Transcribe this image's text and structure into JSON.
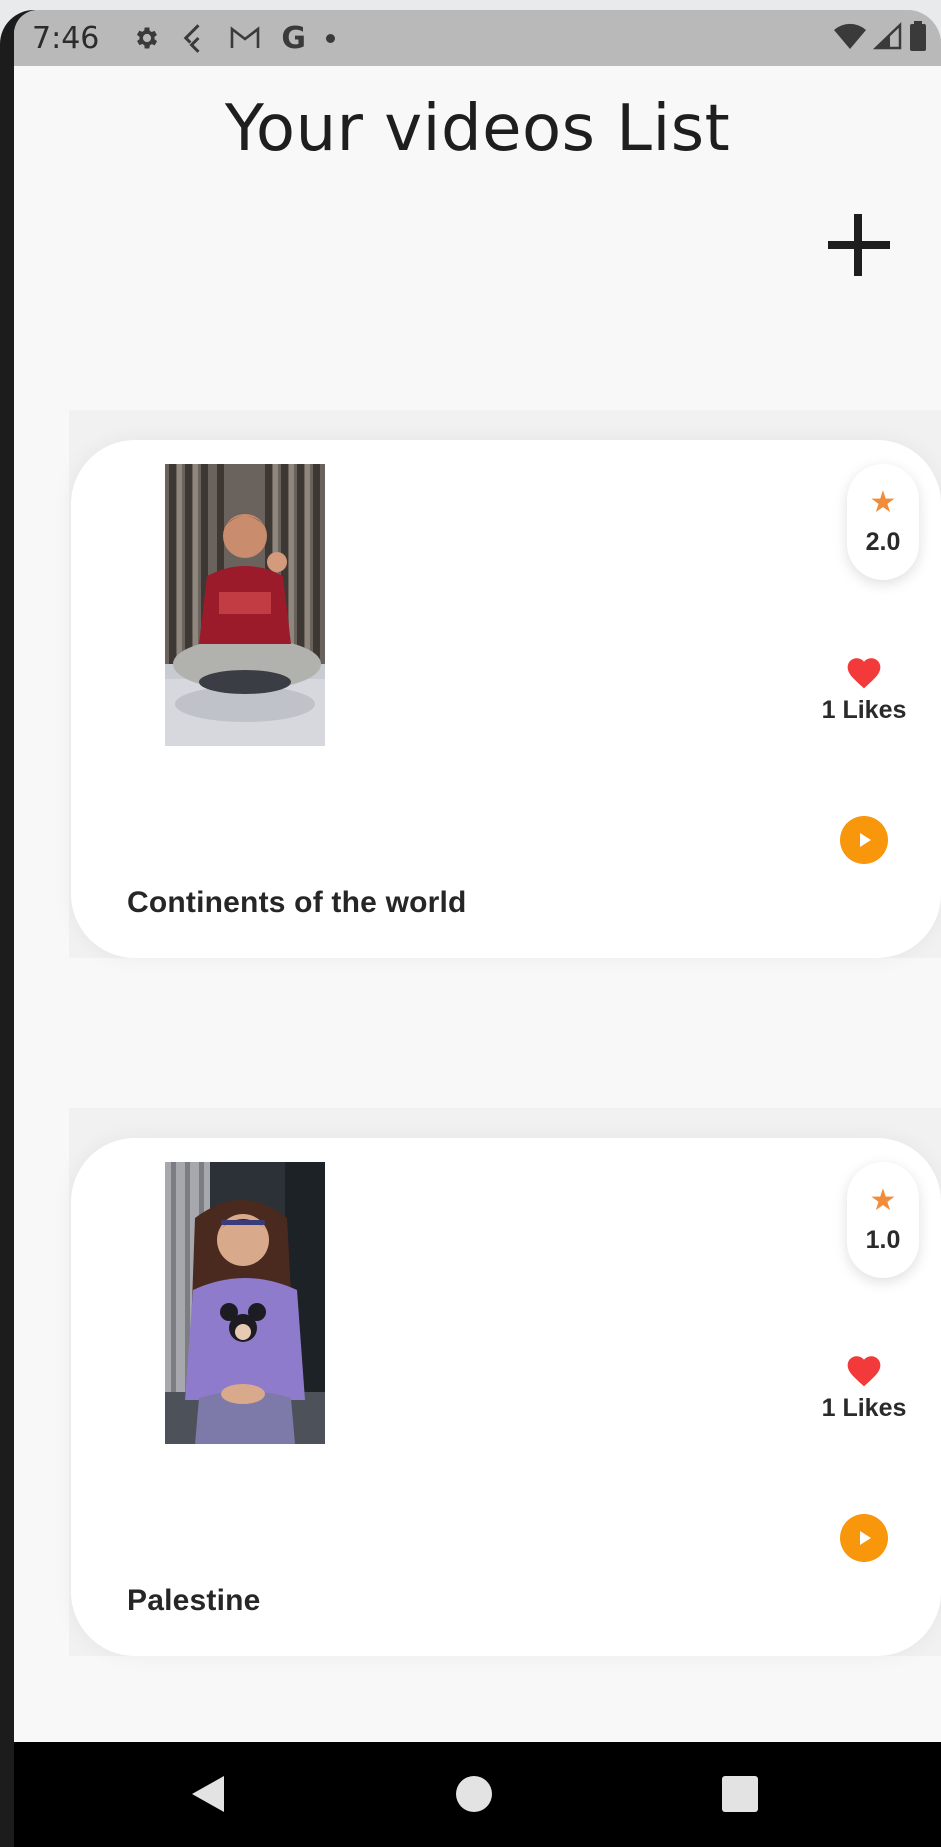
{
  "status_bar": {
    "time": "7:46",
    "icons_left": [
      "gear-icon",
      "flutter-icon",
      "gmail-icon",
      "google-icon",
      "dot-icon"
    ],
    "icons_right": [
      "wifi-icon",
      "signal-icon",
      "battery-icon"
    ]
  },
  "header": {
    "title": "Your videos List",
    "add_icon": "plus-icon"
  },
  "videos": [
    {
      "title": "Continents of the world",
      "rating": "2.0",
      "likes": "1 Likes",
      "thumbnail": "boy-sitting-photo"
    },
    {
      "title": "Palestine",
      "rating": "1.0",
      "likes": "1 Likes",
      "thumbnail": "girl-sitting-photo"
    }
  ],
  "nav_bar": {
    "buttons": [
      "back-icon",
      "home-icon",
      "recents-icon"
    ]
  },
  "colors": {
    "star": "#f08c3a",
    "heart": "#f33a3a",
    "play": "#f8960c",
    "status_bar": "#b9b9b9",
    "background": "#f8f8f8"
  }
}
